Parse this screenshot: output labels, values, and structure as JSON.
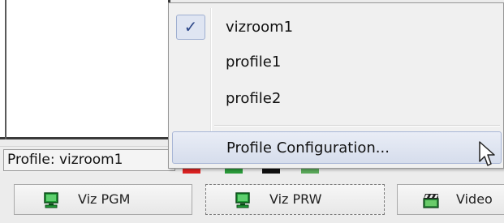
{
  "menu": {
    "items": [
      {
        "label": "vizroom1",
        "checked": true
      },
      {
        "label": "profile1",
        "checked": false
      },
      {
        "label": "profile2",
        "checked": false
      }
    ],
    "config_label": "Profile Configuration...",
    "check_glyph": "✓"
  },
  "status": {
    "profile_text": "Profile: vizroom1"
  },
  "toolbar": {
    "buttons": [
      {
        "label": "Viz PGM",
        "icon": "monitor-icon"
      },
      {
        "label": "Viz PRW",
        "icon": "monitor-icon"
      },
      {
        "label": "Video",
        "icon": "clapperboard-icon"
      }
    ]
  },
  "colors": {
    "highlight": "#d6ddec",
    "check_bg": "#dfe5f2",
    "monitor_green": "#1f9a35"
  }
}
